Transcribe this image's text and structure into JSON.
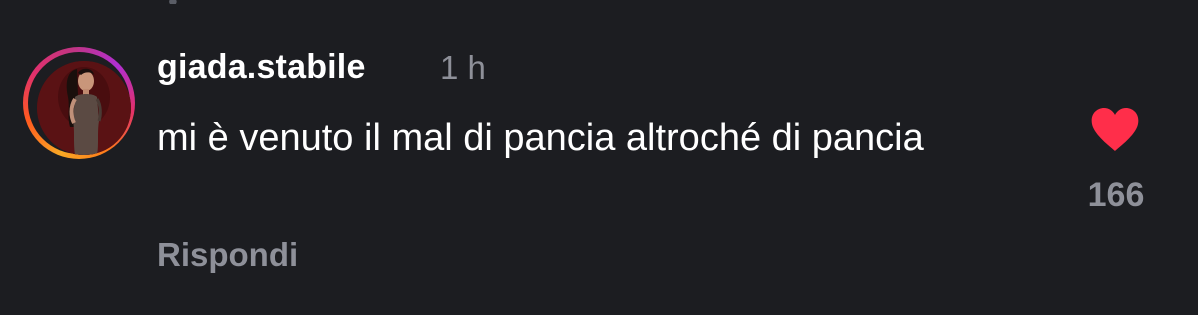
{
  "comment": {
    "username": "giada.stabile",
    "timestamp": "1 h",
    "text": "mi è venuto il mal di pancia altroché di pancia",
    "reply_label": "Rispondi",
    "like_count": "166",
    "liked": true
  },
  "icons": {
    "like": "heart-filled-icon",
    "avatar": "profile-photo"
  },
  "colors": {
    "background": "#1c1d21",
    "text_primary": "#ffffff",
    "text_secondary": "#8e9099",
    "like_active": "#ff2e4a"
  }
}
